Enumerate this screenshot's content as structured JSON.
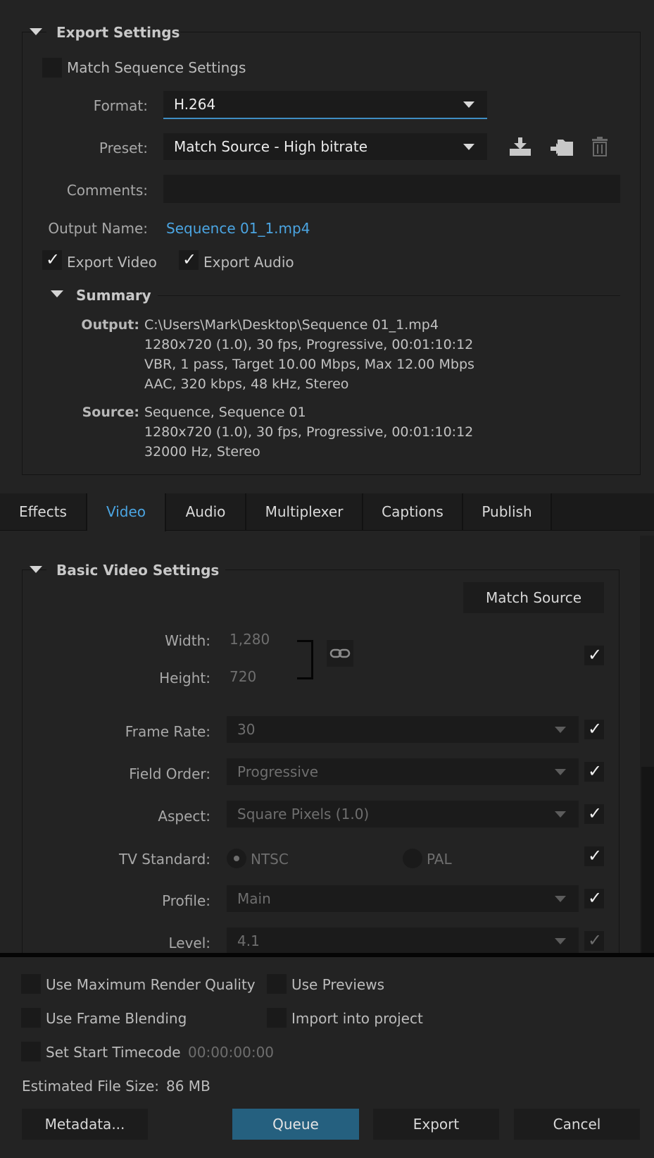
{
  "export_settings": {
    "title": "Export Settings",
    "match_sequence_label": "Match Sequence Settings",
    "format_label": "Format:",
    "format_value": "H.264",
    "preset_label": "Preset:",
    "preset_value": "Match Source - High bitrate",
    "comments_label": "Comments:",
    "comments_value": "",
    "output_name_label": "Output Name:",
    "output_name_value": "Sequence 01_1.mp4",
    "export_video_label": "Export Video",
    "export_audio_label": "Export Audio",
    "icons": [
      "save-preset-icon",
      "import-preset-icon",
      "delete-preset-icon"
    ]
  },
  "summary": {
    "title": "Summary",
    "output_key": "Output:",
    "output_lines": [
      "C:\\Users\\Mark\\Desktop\\Sequence 01_1.mp4",
      "1280x720 (1.0), 30 fps, Progressive, 00:01:10:12",
      "VBR, 1 pass, Target 10.00 Mbps, Max 12.00 Mbps",
      "AAC, 320 kbps, 48 kHz, Stereo"
    ],
    "source_key": "Source:",
    "source_lines": [
      "Sequence, Sequence 01",
      "1280x720 (1.0), 30 fps, Progressive, 00:01:10:12",
      "32000 Hz, Stereo"
    ]
  },
  "tabs": [
    {
      "label": "Effects",
      "active": false
    },
    {
      "label": "Video",
      "active": true
    },
    {
      "label": "Audio",
      "active": false
    },
    {
      "label": "Multiplexer",
      "active": false
    },
    {
      "label": "Captions",
      "active": false
    },
    {
      "label": "Publish",
      "active": false
    }
  ],
  "basic_video": {
    "title": "Basic Video Settings",
    "match_source_button": "Match Source",
    "width_label": "Width:",
    "width_value": "1,280",
    "height_label": "Height:",
    "height_value": "720",
    "frame_rate_label": "Frame Rate:",
    "frame_rate_value": "30",
    "field_order_label": "Field Order:",
    "field_order_value": "Progressive",
    "aspect_label": "Aspect:",
    "aspect_value": "Square Pixels (1.0)",
    "tv_standard_label": "TV Standard:",
    "tv_ntsc": "NTSC",
    "tv_pal": "PAL",
    "profile_label": "Profile:",
    "profile_value": "Main",
    "level_label": "Level:",
    "level_value": "4.1"
  },
  "bottom": {
    "max_render_label": "Use Maximum Render Quality",
    "use_previews_label": "Use Previews",
    "frame_blending_label": "Use Frame Blending",
    "import_project_label": "Import into project",
    "start_timecode_label": "Set Start Timecode",
    "start_timecode_value": "00:00:00:00",
    "estimated_size_label": "Estimated File Size:",
    "estimated_size_value": "86 MB",
    "metadata_button": "Metadata...",
    "queue_button": "Queue",
    "export_button": "Export",
    "cancel_button": "Cancel"
  },
  "colors": {
    "background": "#232323",
    "accent_blue": "#4ba5e2",
    "queue_button": "#25607f"
  }
}
